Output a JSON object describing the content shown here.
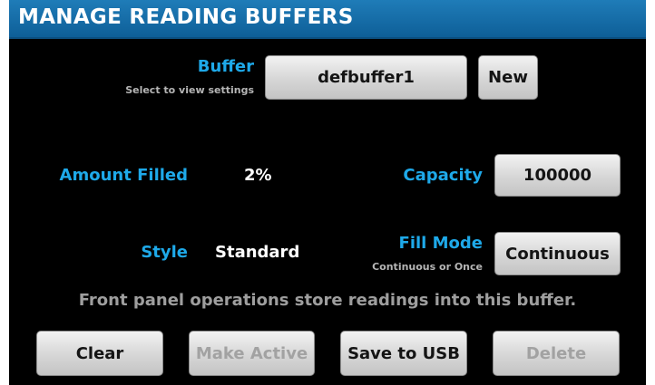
{
  "window": {
    "title": "MANAGE READING BUFFERS"
  },
  "buffer": {
    "label": "Buffer",
    "sublabel": "Select to view settings",
    "value": "defbuffer1",
    "new_label": "New"
  },
  "amount_filled": {
    "label": "Amount Filled",
    "value": "2%"
  },
  "capacity": {
    "label": "Capacity",
    "value": "100000"
  },
  "style": {
    "label": "Style",
    "value": "Standard"
  },
  "fill_mode": {
    "label": "Fill Mode",
    "sublabel": "Continuous or Once",
    "value": "Continuous"
  },
  "info_text": "Front panel operations store readings into this buffer.",
  "actions": {
    "clear": "Clear",
    "make_active": "Make Active",
    "save_to_usb": "Save to USB",
    "delete": "Delete"
  },
  "colors": {
    "title_bar": "#1f7cb8",
    "label_accent": "#1ea9e9",
    "background": "#000000",
    "disabled_text": "#a2a2a2"
  }
}
